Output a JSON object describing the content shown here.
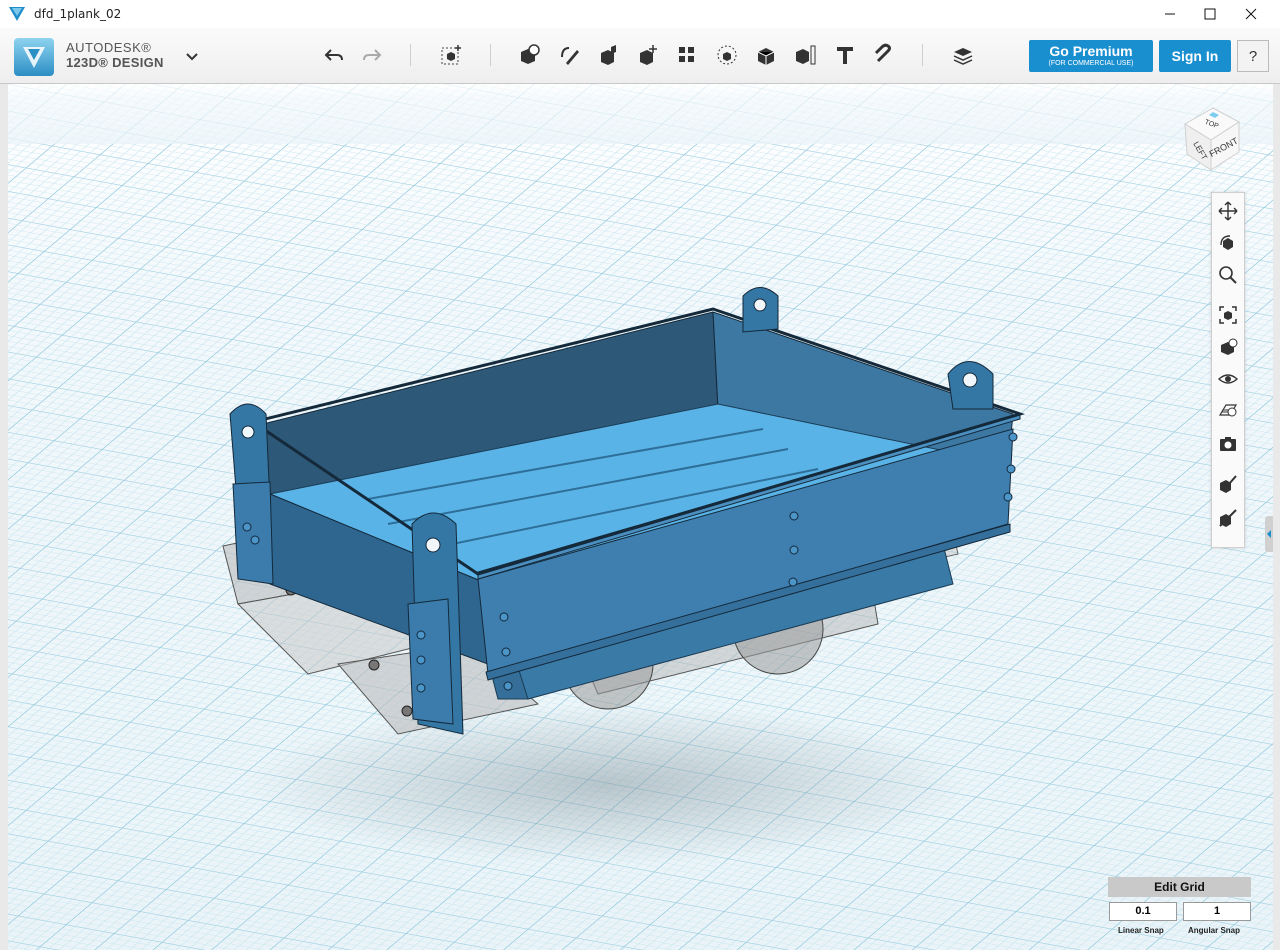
{
  "window": {
    "title": "dfd_1plank_02"
  },
  "brand": {
    "line1": "AUTODESK®",
    "line2": "123D® DESIGN"
  },
  "toolbar": {
    "tools": [
      "undo-icon",
      "redo-icon",
      "transform-icon",
      "primitives-icon",
      "sketch-icon",
      "construct-icon",
      "modify-icon",
      "pattern-icon",
      "grouping-icon",
      "combine-icon",
      "measure-icon",
      "text-icon",
      "snap-icon",
      "material-icon"
    ]
  },
  "premium": {
    "title": "Go Premium",
    "subtitle": "(FOR COMMERCIAL USE)"
  },
  "signin": {
    "label": "Sign In"
  },
  "help": {
    "label": "?"
  },
  "viewcube": {
    "top": "TOP",
    "left": "LEFT",
    "front": "FRONT"
  },
  "nav": [
    "pan-icon",
    "orbit-icon",
    "zoom-icon",
    "fit-icon",
    "views-icon",
    "visibility-icon",
    "materials-icon",
    "screenshot-icon",
    "solid-icon",
    "hide-icon"
  ],
  "grid": {
    "title": "Edit Grid",
    "linear_value": "0.1",
    "linear_label": "Linear Snap",
    "angular_value": "1",
    "angular_label": "Angular Snap"
  },
  "colors": {
    "accent": "#1a8fd0",
    "model": "#3d7eaa",
    "grid": "#9ccde0"
  }
}
